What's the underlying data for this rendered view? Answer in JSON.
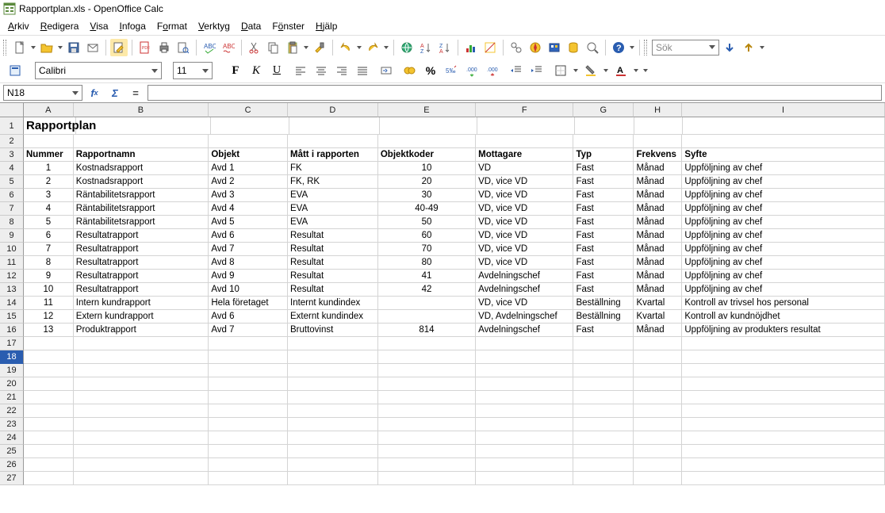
{
  "title": "Rapportplan.xls - OpenOffice Calc",
  "menu": [
    "Arkiv",
    "Redigera",
    "Visa",
    "Infoga",
    "Format",
    "Verktyg",
    "Data",
    "Fönster",
    "Hjälp"
  ],
  "menu_underline_idx": [
    0,
    0,
    0,
    0,
    1,
    0,
    0,
    1,
    0
  ],
  "font_name": "Calibri",
  "font_size": "11",
  "cell_ref": "N18",
  "formula": "",
  "search_placeholder": "Sök",
  "col_labels": [
    "A",
    "B",
    "C",
    "D",
    "E",
    "F",
    "G",
    "H",
    "I"
  ],
  "row_count": 27,
  "selected_row": 18,
  "sheet": {
    "title": "Rapportplan",
    "headers": [
      "Nummer",
      "Rapportnamn",
      "Objekt",
      "Mått i rapporten",
      "Objektkoder",
      "Mottagare",
      "Typ",
      "Frekvens",
      "Syfte"
    ],
    "rows": [
      {
        "n": "1",
        "namn": "Kostnadsrapport",
        "obj": "Avd 1",
        "matt": "FK",
        "kod": "10",
        "mot": "VD",
        "typ": "Fast",
        "frek": "Månad",
        "syfte": "Uppföljning av chef"
      },
      {
        "n": "2",
        "namn": "Kostnadsrapport",
        "obj": "Avd 2",
        "matt": "FK, RK",
        "kod": "20",
        "mot": "VD, vice VD",
        "typ": "Fast",
        "frek": "Månad",
        "syfte": "Uppföljning av chef"
      },
      {
        "n": "3",
        "namn": "Räntabilitetsrapport",
        "obj": "Avd 3",
        "matt": "EVA",
        "kod": "30",
        "mot": "VD, vice VD",
        "typ": "Fast",
        "frek": "Månad",
        "syfte": "Uppföljning av chef"
      },
      {
        "n": "4",
        "namn": "Räntabilitetsrapport",
        "obj": "Avd 4",
        "matt": "EVA",
        "kod": "40-49",
        "mot": "VD, vice VD",
        "typ": "Fast",
        "frek": "Månad",
        "syfte": "Uppföljning av chef"
      },
      {
        "n": "5",
        "namn": "Räntabilitetsrapport",
        "obj": "Avd 5",
        "matt": "EVA",
        "kod": "50",
        "mot": "VD, vice VD",
        "typ": "Fast",
        "frek": "Månad",
        "syfte": "Uppföljning av chef"
      },
      {
        "n": "6",
        "namn": "Resultatrapport",
        "obj": "Avd 6",
        "matt": "Resultat",
        "kod": "60",
        "mot": "VD, vice VD",
        "typ": "Fast",
        "frek": "Månad",
        "syfte": "Uppföljning av chef"
      },
      {
        "n": "7",
        "namn": "Resultatrapport",
        "obj": "Avd 7",
        "matt": "Resultat",
        "kod": "70",
        "mot": "VD, vice VD",
        "typ": "Fast",
        "frek": "Månad",
        "syfte": "Uppföljning av chef"
      },
      {
        "n": "8",
        "namn": "Resultatrapport",
        "obj": "Avd 8",
        "matt": "Resultat",
        "kod": "80",
        "mot": "VD, vice VD",
        "typ": "Fast",
        "frek": "Månad",
        "syfte": "Uppföljning av chef"
      },
      {
        "n": "9",
        "namn": "Resultatrapport",
        "obj": "Avd 9",
        "matt": "Resultat",
        "kod": "41",
        "mot": "Avdelningschef",
        "typ": "Fast",
        "frek": "Månad",
        "syfte": "Uppföljning av chef"
      },
      {
        "n": "10",
        "namn": "Resultatrapport",
        "obj": "Avd 10",
        "matt": "Resultat",
        "kod": "42",
        "mot": "Avdelningschef",
        "typ": "Fast",
        "frek": "Månad",
        "syfte": "Uppföljning av chef"
      },
      {
        "n": "11",
        "namn": "Intern kundrapport",
        "obj": "Hela företaget",
        "matt": "Internt kundindex",
        "kod": "",
        "mot": "VD, vice VD",
        "typ": "Beställning",
        "frek": "Kvartal",
        "syfte": "Kontroll av trivsel hos personal"
      },
      {
        "n": "12",
        "namn": "Extern kundrapport",
        "obj": "Avd 6",
        "matt": "Externt kundindex",
        "kod": "",
        "mot": "VD, Avdelningschef",
        "typ": "Beställning",
        "frek": "Kvartal",
        "syfte": "Kontroll av kundnöjdhet"
      },
      {
        "n": "13",
        "namn": "Produktrapport",
        "obj": "Avd 7",
        "matt": "Bruttovinst",
        "kod": "814",
        "mot": "Avdelningschef",
        "typ": "Fast",
        "frek": "Månad",
        "syfte": "Uppföljning av produkters resultat"
      }
    ]
  }
}
